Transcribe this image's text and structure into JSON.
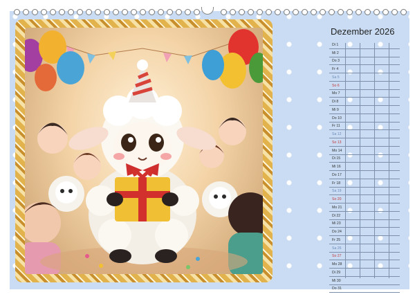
{
  "calendar": {
    "month_title": "Dezember 2026",
    "days": [
      {
        "label": "Di 1",
        "kind": "weekday"
      },
      {
        "label": "Mi 2",
        "kind": "weekday"
      },
      {
        "label": "Do 3",
        "kind": "weekday"
      },
      {
        "label": "Fr 4",
        "kind": "weekday"
      },
      {
        "label": "Sa 5",
        "kind": "saturday"
      },
      {
        "label": "So 6",
        "kind": "sunday"
      },
      {
        "label": "Mo 7",
        "kind": "weekday"
      },
      {
        "label": "Di 8",
        "kind": "weekday"
      },
      {
        "label": "Mi 9",
        "kind": "weekday"
      },
      {
        "label": "Do 10",
        "kind": "weekday"
      },
      {
        "label": "Fr 11",
        "kind": "weekday"
      },
      {
        "label": "Sa 12",
        "kind": "saturday"
      },
      {
        "label": "So 13",
        "kind": "sunday"
      },
      {
        "label": "Mo 14",
        "kind": "weekday"
      },
      {
        "label": "Di 15",
        "kind": "weekday"
      },
      {
        "label": "Mi 16",
        "kind": "weekday"
      },
      {
        "label": "Do 17",
        "kind": "weekday"
      },
      {
        "label": "Fr 18",
        "kind": "weekday"
      },
      {
        "label": "Sa 19",
        "kind": "saturday"
      },
      {
        "label": "So 20",
        "kind": "sunday"
      },
      {
        "label": "Mo 21",
        "kind": "weekday"
      },
      {
        "label": "Di 22",
        "kind": "weekday"
      },
      {
        "label": "Mi 23",
        "kind": "weekday"
      },
      {
        "label": "Do 24",
        "kind": "weekday"
      },
      {
        "label": "Fr 25",
        "kind": "weekday"
      },
      {
        "label": "Sa 26",
        "kind": "saturday"
      },
      {
        "label": "So 27",
        "kind": "sunday"
      },
      {
        "label": "Mo 28",
        "kind": "weekday"
      },
      {
        "label": "Di 29",
        "kind": "weekday"
      },
      {
        "label": "Mi 30",
        "kind": "weekday"
      },
      {
        "label": "Do 31",
        "kind": "weekday"
      }
    ]
  },
  "colors": {
    "background": "#c9dcf3",
    "frame_gold": "#e2b24c",
    "sunday_red": "#c23a3a",
    "saturday_blue": "#6d8bb8"
  }
}
